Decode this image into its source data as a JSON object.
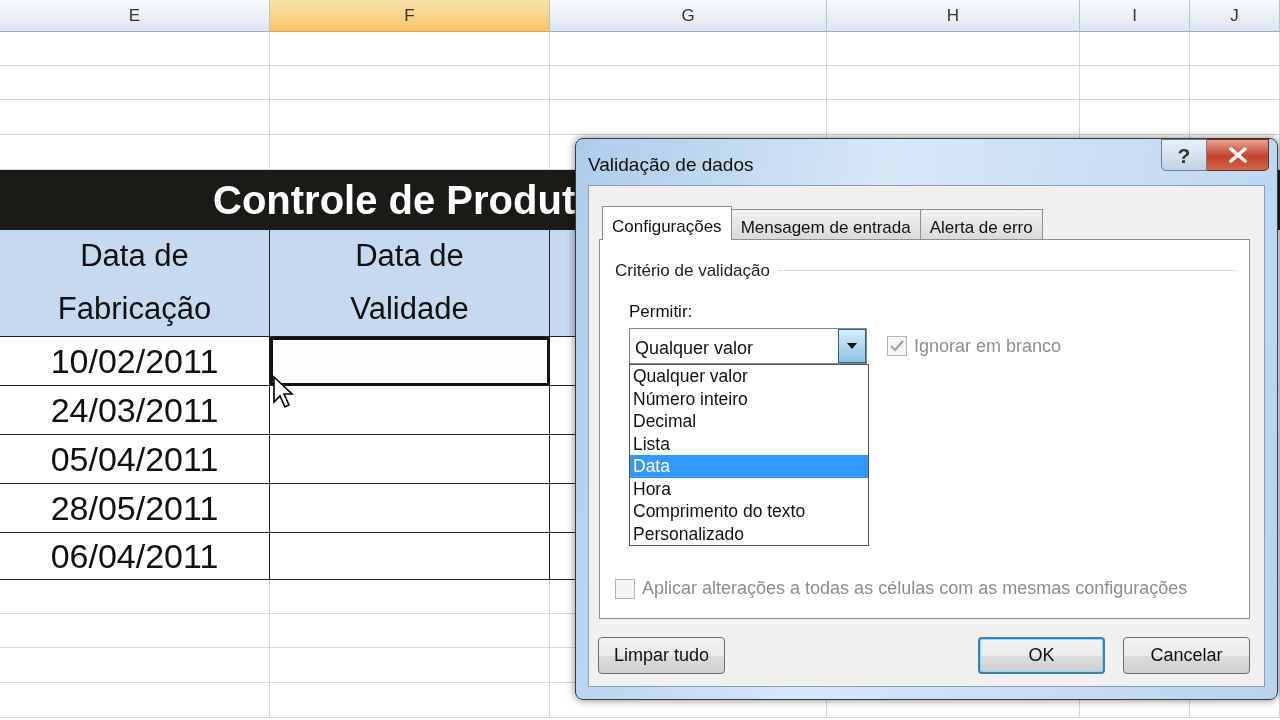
{
  "spreadsheet": {
    "column_headers": [
      {
        "label": "E",
        "selected": false
      },
      {
        "label": "F",
        "selected": true
      },
      {
        "label": "G",
        "selected": false
      },
      {
        "label": "H",
        "selected": false
      },
      {
        "label": "I",
        "selected": false
      },
      {
        "label": "J",
        "selected": false
      }
    ],
    "title": "Controle de Produt",
    "table_headers": [
      {
        "lines": [
          "Data de",
          "Fabricação"
        ]
      },
      {
        "lines": [
          "Data de",
          "Validade"
        ]
      }
    ],
    "rows": [
      {
        "manufacture_date": "10/02/2011",
        "expiry_selected": true
      },
      {
        "manufacture_date": "24/03/2011",
        "expiry_selected": false
      },
      {
        "manufacture_date": "05/04/2011",
        "expiry_selected": false
      },
      {
        "manufacture_date": "28/05/2011",
        "expiry_selected": false
      },
      {
        "manufacture_date": "06/04/2011",
        "expiry_selected": false
      }
    ]
  },
  "dialog": {
    "title": "Validação de dados",
    "help_button": "?",
    "tabs": [
      {
        "label": "Configurações",
        "selected": true
      },
      {
        "label": "Mensagem de entrada",
        "selected": false
      },
      {
        "label": "Alerta de erro",
        "selected": false
      }
    ],
    "section": "Critério de validação",
    "allow_label": "Permitir:",
    "allow_value": "Qualquer valor",
    "dropdown_expanded": true,
    "options": [
      {
        "label": "Qualquer valor",
        "selected": false
      },
      {
        "label": "Número inteiro",
        "selected": false
      },
      {
        "label": "Decimal",
        "selected": false
      },
      {
        "label": "Lista",
        "selected": false
      },
      {
        "label": "Data",
        "selected": true
      },
      {
        "label": "Hora",
        "selected": false
      },
      {
        "label": "Comprimento do texto",
        "selected": false
      },
      {
        "label": "Personalizado",
        "selected": false
      }
    ],
    "ignore_blank": {
      "label": "Ignorar em branco",
      "checked": true,
      "disabled": true
    },
    "apply_all": {
      "label": "Aplicar alterações a todas as células com as mesmas configurações",
      "checked": false,
      "disabled": true
    },
    "buttons": [
      {
        "label": "Limpar tudo",
        "default": false
      },
      {
        "label": "OK",
        "default": true
      },
      {
        "label": "Cancelar",
        "default": false
      }
    ]
  }
}
